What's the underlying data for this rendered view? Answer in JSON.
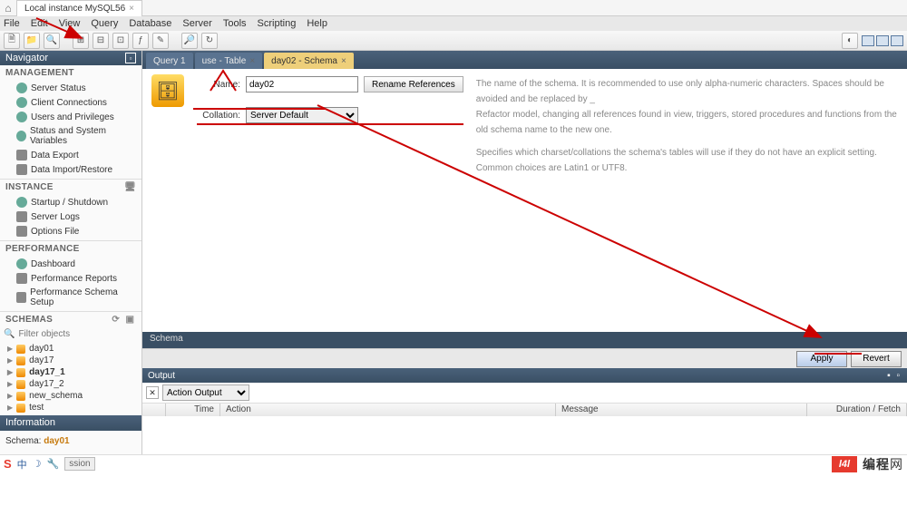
{
  "title_tab": "Local instance MySQL56",
  "menubar": [
    "File",
    "Edit",
    "View",
    "Query",
    "Database",
    "Server",
    "Tools",
    "Scripting",
    "Help"
  ],
  "navigator": {
    "header": "Navigator",
    "management_title": "MANAGEMENT",
    "management": [
      "Server Status",
      "Client Connections",
      "Users and Privileges",
      "Status and System Variables",
      "Data Export",
      "Data Import/Restore"
    ],
    "instance_title": "INSTANCE",
    "instance": [
      "Startup / Shutdown",
      "Server Logs",
      "Options File"
    ],
    "performance_title": "PERFORMANCE",
    "performance": [
      "Dashboard",
      "Performance Reports",
      "Performance Schema Setup"
    ],
    "schemas_title": "SCHEMAS",
    "search_placeholder": "Filter objects",
    "schemas": [
      "day01",
      "day17",
      "day17_1",
      "day17_2",
      "new_schema",
      "test"
    ],
    "info_header": "Information",
    "info_label": "Schema:",
    "info_value": "day01"
  },
  "tabs": [
    {
      "label": "Query 1",
      "active": false
    },
    {
      "label": "use - Table",
      "active": false
    },
    {
      "label": "day02 - Schema",
      "active": true
    }
  ],
  "editor": {
    "name_label": "Name:",
    "name_value": "day02",
    "rename_btn": "Rename References",
    "collation_label": "Collation:",
    "collation_value": "Server Default",
    "desc1": "The name of the schema. It is recommended to use only alpha-numeric characters. Spaces should be avoided and be replaced by _",
    "desc2": "Refactor model, changing all references found in view, triggers, stored procedures and functions from the old schema name to the new one.",
    "desc3": "Specifies which charset/collations the schema's tables will use if they do not have an explicit setting. Common choices are Latin1 or UTF8."
  },
  "schema_bar": "Schema",
  "apply": "Apply",
  "revert": "Revert",
  "output": {
    "header": "Output",
    "select": "Action Output",
    "cols": {
      "time": "Time",
      "action": "Action",
      "message": "Message",
      "duration": "Duration / Fetch"
    }
  },
  "taskbar_hint": "ssion",
  "watermark": "编程网"
}
